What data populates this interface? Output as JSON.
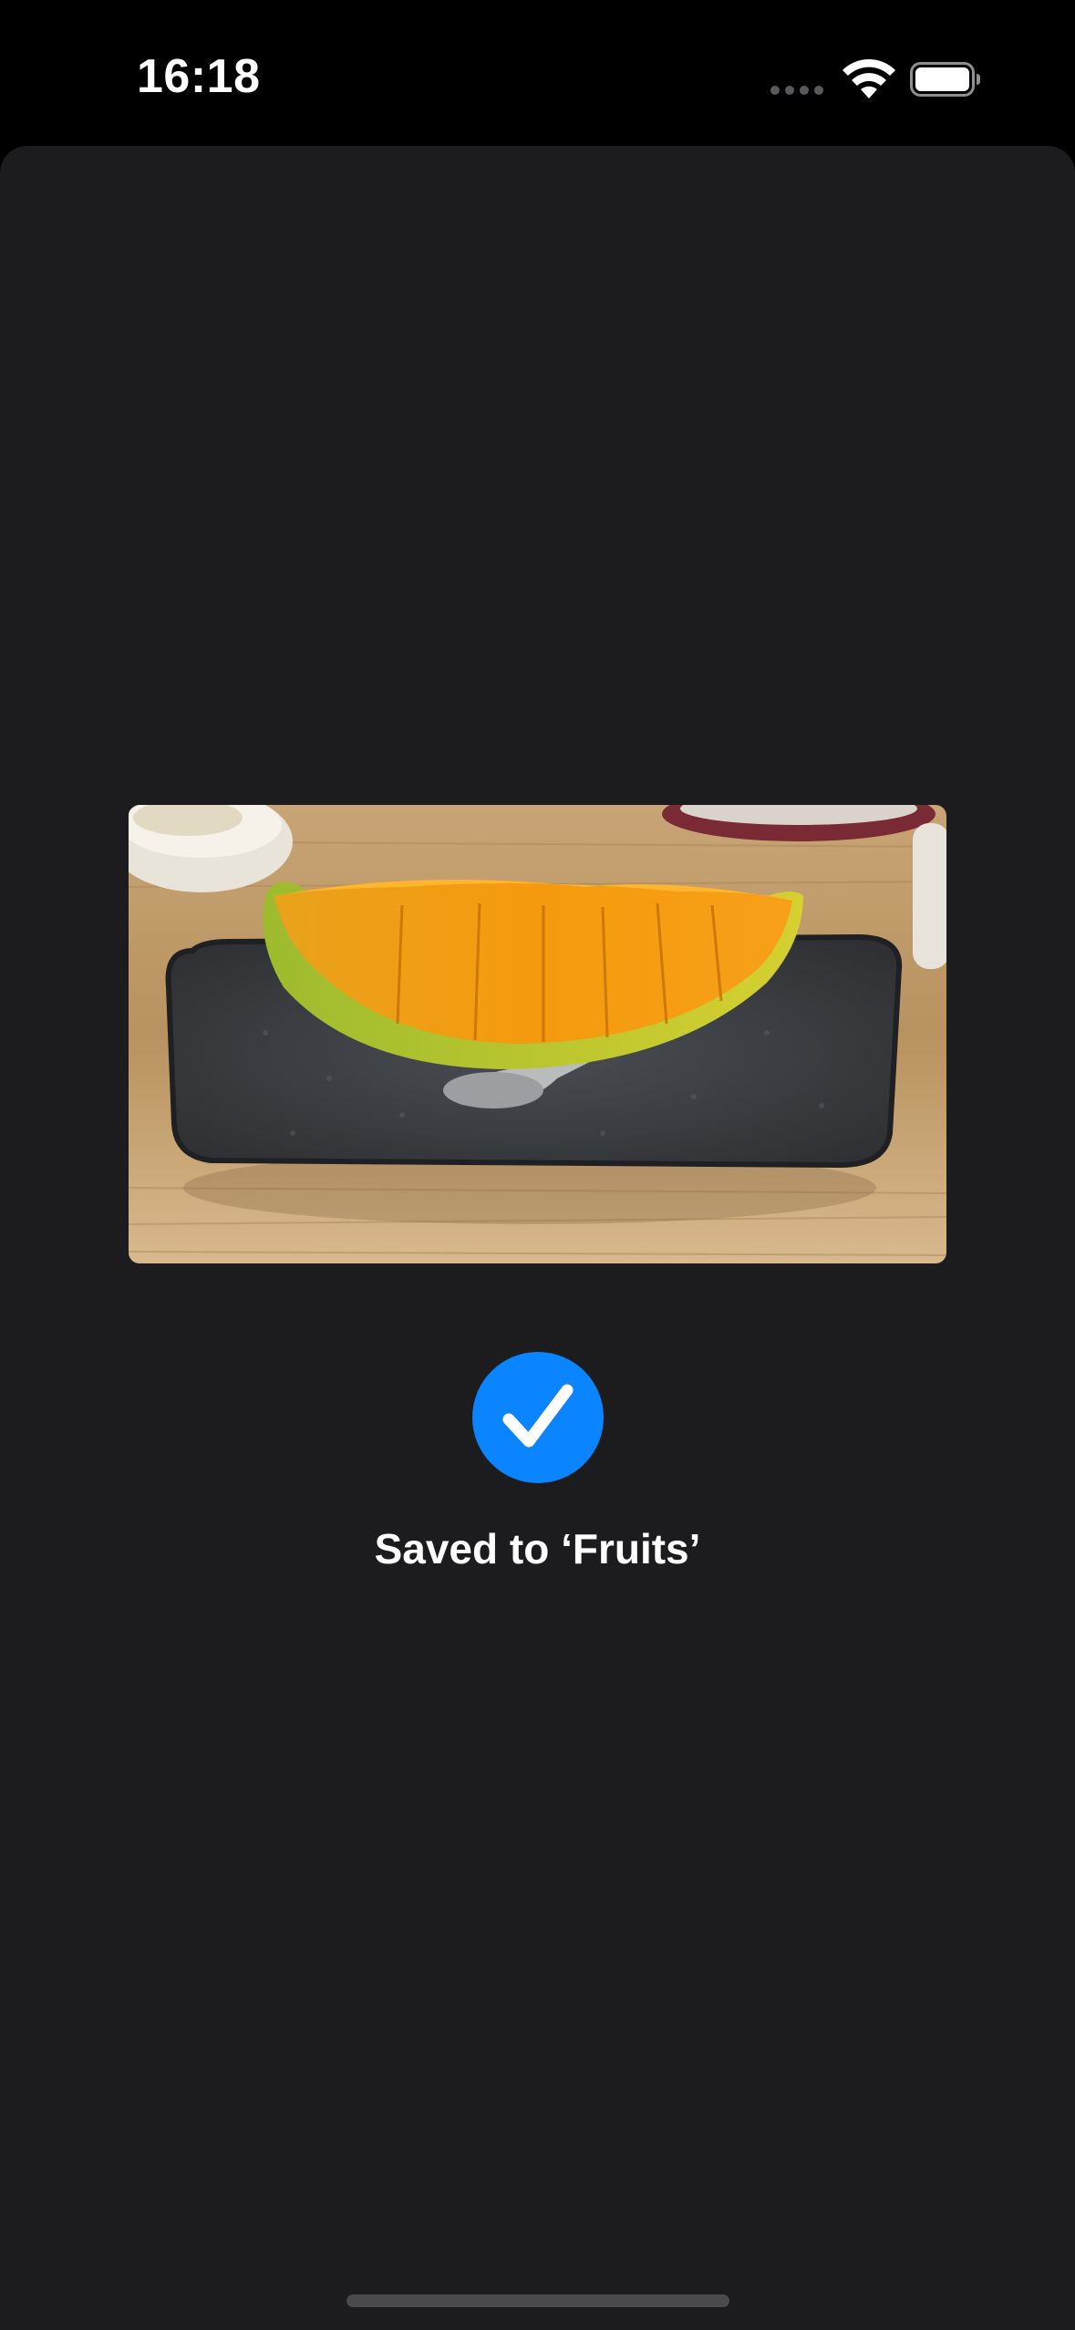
{
  "status_bar": {
    "time": "16:18",
    "icons": [
      "cellular-signal-icon",
      "wifi-icon",
      "battery-icon"
    ]
  },
  "photo": {
    "subject": "melon-slice-photo"
  },
  "confirmation": {
    "icon": "checkmark-icon",
    "message": "Saved to ‘Fruits’",
    "accent_color": "#0a84ff"
  },
  "colors": {
    "background": "#1c1c1e",
    "status_bar": "#000000",
    "text": "#ffffff"
  }
}
